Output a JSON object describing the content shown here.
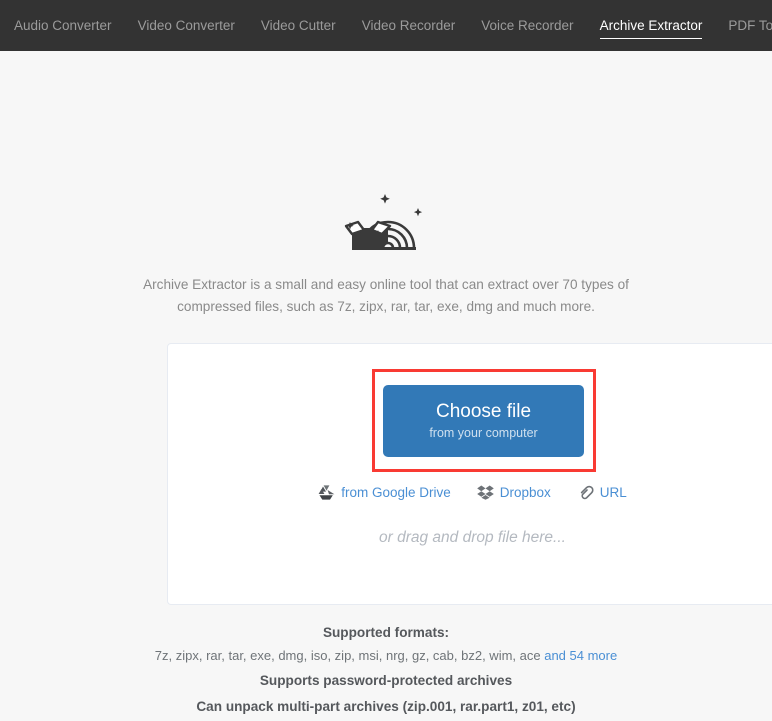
{
  "nav": {
    "items": [
      {
        "label": "Audio Converter",
        "active": false
      },
      {
        "label": "Video Converter",
        "active": false
      },
      {
        "label": "Video Cutter",
        "active": false
      },
      {
        "label": "Video Recorder",
        "active": false
      },
      {
        "label": "Voice Recorder",
        "active": false
      },
      {
        "label": "Archive Extractor",
        "active": true
      },
      {
        "label": "PDF Tools",
        "active": false
      }
    ]
  },
  "hero": {
    "icon": "archive-rainbow-box-icon",
    "description": "Archive Extractor is a small and easy online tool that can extract over 70 types of compressed files, such as 7z, zipx, rar, tar, exe, dmg and much more."
  },
  "upload": {
    "choose_button": {
      "main_label": "Choose file",
      "sub_label": "from your computer",
      "color": "#3279b7"
    },
    "highlight_color": "#f93a33",
    "services": [
      {
        "icon": "google-drive-icon",
        "label": "from Google Drive"
      },
      {
        "icon": "dropbox-icon",
        "label": "Dropbox"
      },
      {
        "icon": "link-paperclip-icon",
        "label": "URL"
      }
    ],
    "drag_drop_text": "or drag and drop file here..."
  },
  "footer": {
    "supported_formats_title": "Supported formats:",
    "supported_formats_list": "7z, zipx, rar, tar, exe, dmg, iso, zip, msi, nrg, gz, cab, bz2, wim, ace",
    "more_link": "and 54 more",
    "password_line": "Supports password-protected archives",
    "multipart_line": "Can unpack multi-part archives (zip.001, rar.part1, z01, etc)"
  }
}
